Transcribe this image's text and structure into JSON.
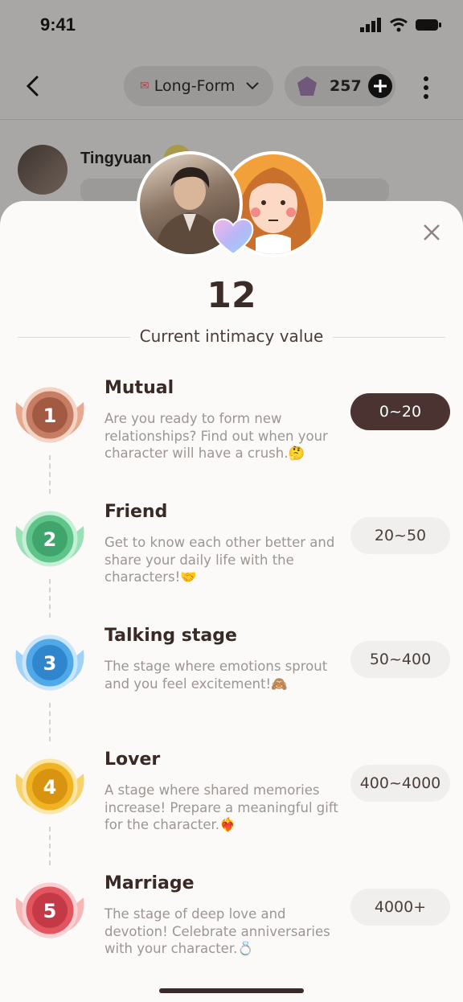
{
  "status": {
    "time": "9:41"
  },
  "nav": {
    "mode_label": "Long-Form",
    "coins": "257"
  },
  "chat": {
    "name": "Tingyuan"
  },
  "sheet": {
    "intimacy_value": "12",
    "intimacy_label": "Current intimacy value",
    "levels": [
      {
        "title": "Mutual",
        "desc": "Are you ready to form new relationships? Find out when your character will have a crush.🤔",
        "range": "0~20",
        "active": true,
        "badge": "lv1",
        "color": "#c77d63"
      },
      {
        "title": "Friend",
        "desc": "Get to know each other better and share your daily life with the characters!🤝",
        "range": "20~50",
        "active": false,
        "badge": "lv2",
        "color": "#5fc48a"
      },
      {
        "title": "Talking stage",
        "desc": "The stage where emotions sprout and you feel excitement!🙈",
        "range": "50~400",
        "active": false,
        "badge": "lv3",
        "color": "#4fa8e8"
      },
      {
        "title": "Lover",
        "desc": "A stage where shared memories increase! Prepare a meaningful gift for the character.❤️‍🔥",
        "range": "400~4000",
        "active": false,
        "badge": "lv4",
        "color": "#f0b323"
      },
      {
        "title": "Marriage",
        "desc": "The stage of deep love and devotion! Celebrate anniversaries with your character.💍",
        "range": "4000+",
        "active": false,
        "badge": "lv5",
        "color": "#e2555f"
      }
    ]
  }
}
